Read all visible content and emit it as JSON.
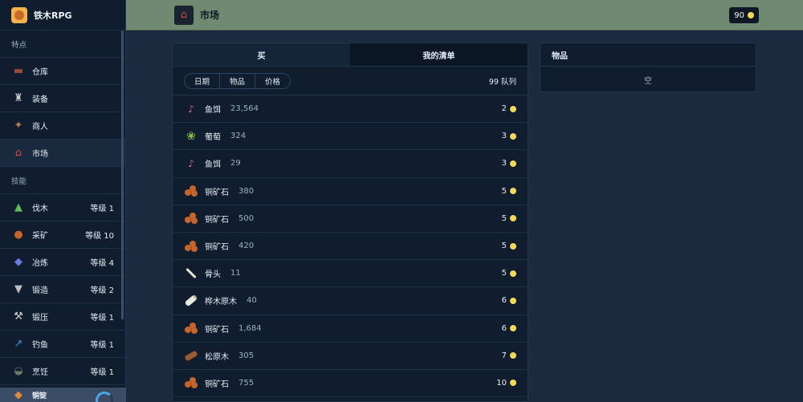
{
  "app": {
    "name": "铁木RPG"
  },
  "sidebar": {
    "section_features": "特点",
    "section_skills": "技能",
    "features": [
      {
        "label": "仓库",
        "icon": "chest-icon"
      },
      {
        "label": "装备",
        "icon": "armor-icon"
      },
      {
        "label": "商人",
        "icon": "merchant-icon"
      },
      {
        "label": "市场",
        "icon": "market-icon",
        "active": true
      }
    ],
    "skills": [
      {
        "label": "伐木",
        "level": "等级 1",
        "icon": "tree-icon"
      },
      {
        "label": "采矿",
        "level": "等级 10",
        "icon": "ore-icon"
      },
      {
        "label": "冶炼",
        "level": "等级 4",
        "icon": "ingot-icon"
      },
      {
        "label": "锻造",
        "level": "等级 2",
        "icon": "anvil-icon"
      },
      {
        "label": "锻压",
        "level": "等级 1",
        "icon": "hammer-icon"
      },
      {
        "label": "钓鱼",
        "level": "等级 1",
        "icon": "fishing-rod-icon"
      },
      {
        "label": "烹饪",
        "level": "等级 1",
        "icon": "cauldron-icon"
      }
    ],
    "footer": {
      "label": "铜锭"
    }
  },
  "topbar": {
    "title": "市场",
    "gold": "90"
  },
  "market": {
    "tabs": [
      {
        "label": "买",
        "active": true
      },
      {
        "label": "我的清单",
        "active": false
      }
    ],
    "sort_buttons": [
      "日期",
      "物品",
      "价格"
    ],
    "queue": "99 队列",
    "listings": [
      {
        "name": "鱼饵",
        "qty": "23,564",
        "price": "2",
        "icon": "bait"
      },
      {
        "name": "葡萄",
        "qty": "324",
        "price": "3",
        "icon": "grape"
      },
      {
        "name": "鱼饵",
        "qty": "29",
        "price": "3",
        "icon": "bait"
      },
      {
        "name": "铜矿石",
        "qty": "380",
        "price": "5",
        "icon": "ore"
      },
      {
        "name": "铜矿石",
        "qty": "500",
        "price": "5",
        "icon": "ore"
      },
      {
        "name": "铜矿石",
        "qty": "420",
        "price": "5",
        "icon": "ore"
      },
      {
        "name": "骨头",
        "qty": "11",
        "price": "5",
        "icon": "bone"
      },
      {
        "name": "桦木原木",
        "qty": "40",
        "price": "6",
        "icon": "birch"
      },
      {
        "name": "铜矿石",
        "qty": "1,684",
        "price": "6",
        "icon": "ore"
      },
      {
        "name": "松原木",
        "qty": "305",
        "price": "7",
        "icon": "log"
      },
      {
        "name": "铜矿石",
        "qty": "755",
        "price": "10",
        "icon": "ore"
      }
    ]
  },
  "items_panel": {
    "title": "物品",
    "empty": "空"
  },
  "colors": {
    "topbar": "#6f8a70",
    "coin": "#f3d85a",
    "accent": "#4aa8e6"
  }
}
